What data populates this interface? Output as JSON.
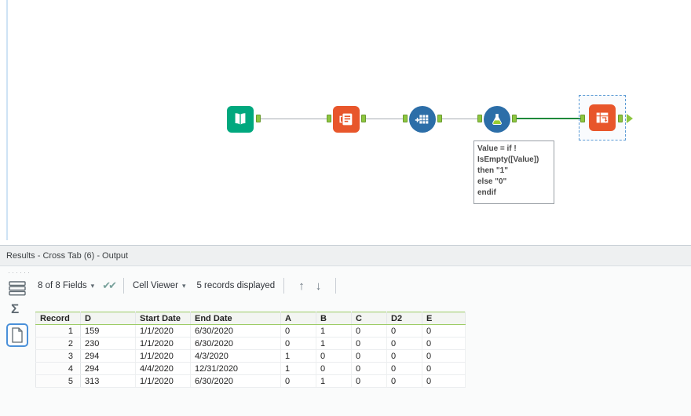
{
  "colors": {
    "tool_teal": "#00a87e",
    "tool_orange": "#e8562b",
    "tool_blue": "#2c6ea8",
    "anchor_green": "#8dc63f",
    "connection_selected_green": "#1f8a3b",
    "selection_blue": "#5b9bd5",
    "grid_header_green": "#9ccc65"
  },
  "icons": {
    "caret_down": "▾",
    "arrow_up": "↑",
    "arrow_down": "↓",
    "double_check": "✔✔"
  },
  "canvas": {
    "annotation": {
      "lines": [
        "Value = if !",
        "IsEmpty([Value])",
        "then \"1\"",
        "else \"0\"",
        "endif"
      ]
    }
  },
  "results": {
    "title": "Results - Cross Tab (6) - Output",
    "toolbar": {
      "fields_label": "8 of 8 Fields",
      "cell_viewer_label": "Cell Viewer",
      "records_label": "5 records displayed"
    },
    "table": {
      "headers": [
        "Record",
        "D",
        "Start Date",
        "End Date",
        "A",
        "B",
        "C",
        "D2",
        "E"
      ],
      "rows": [
        [
          "1",
          "159",
          "1/1/2020",
          "6/30/2020",
          "0",
          "1",
          "0",
          "0",
          "0"
        ],
        [
          "2",
          "230",
          "1/1/2020",
          "6/30/2020",
          "0",
          "1",
          "0",
          "0",
          "0"
        ],
        [
          "3",
          "294",
          "1/1/2020",
          "4/3/2020",
          "1",
          "0",
          "0",
          "0",
          "0"
        ],
        [
          "4",
          "294",
          "4/4/2020",
          "12/31/2020",
          "1",
          "0",
          "0",
          "0",
          "0"
        ],
        [
          "5",
          "313",
          "1/1/2020",
          "6/30/2020",
          "0",
          "1",
          "0",
          "0",
          "0"
        ]
      ]
    }
  }
}
